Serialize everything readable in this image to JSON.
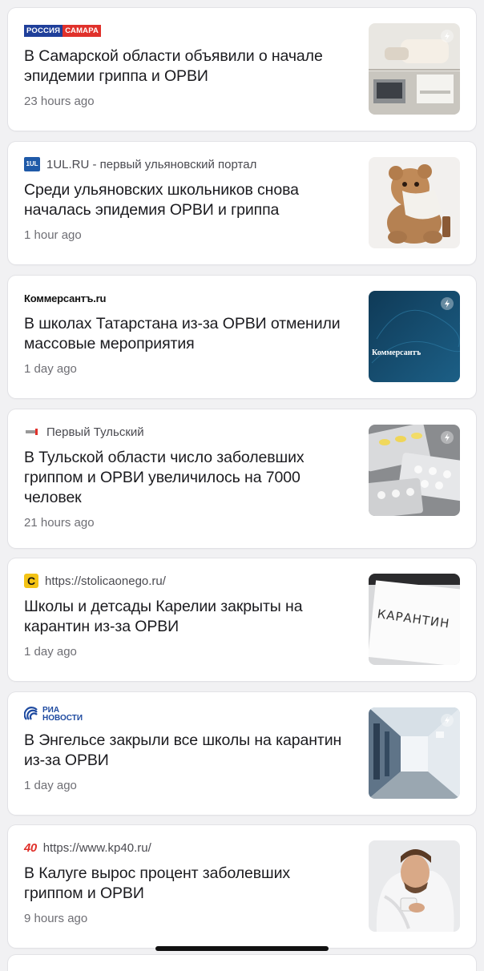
{
  "feed": {
    "articles": [
      {
        "source": "РОССИЯ САМАРА",
        "source_logo_parts": [
          "РОССИЯ",
          "САМАРА"
        ],
        "title": "В Самарской области объявили о начале эпидемии гриппа и ОРВИ",
        "time": "23 hours ago",
        "thumb_icon": "hand-with-paper-icon",
        "amp": true
      },
      {
        "source": "1UL.RU - первый ульяновский портал",
        "source_logo": "1UL",
        "title": "Среди ульяновских школьников снова началась эпидемия ОРВИ и гриппа",
        "time": "1 hour ago",
        "thumb_icon": "teddy-bear-icon",
        "amp": false
      },
      {
        "source": "Коммерсантъ.ru",
        "title": "В школах Татарстана из-за ОРВИ отменили массовые мероприятия",
        "time": "1 day ago",
        "thumb_icon": "kommersant-placeholder-icon",
        "thumb_caption": "Коммерсантъ",
        "amp": true
      },
      {
        "source": "Первый Тульский",
        "title": "В Тульской области число заболевших гриппом и ОРВИ увеличилось на 7000 человек",
        "time": "21 hours ago",
        "thumb_icon": "pills-blister-icon",
        "amp": true
      },
      {
        "source": "https://stolicaonego.ru/",
        "source_logo": "C",
        "title": "Школы и детсады Карелии закрыты на карантин из-за ОРВИ",
        "time": "1 day ago",
        "thumb_icon": "quarantine-sign-icon",
        "thumb_caption": "КАРАНТИН",
        "amp": false
      },
      {
        "source": "РИА НОВОСТИ",
        "source_logo_parts": [
          "РИА",
          "НОВОСТИ"
        ],
        "title": "В Энгельсе закрыли все школы на карантин из-за ОРВИ",
        "time": "1 day ago",
        "thumb_icon": "school-corridor-icon",
        "amp": true
      },
      {
        "source": "https://www.kp40.ru/",
        "source_logo": "40",
        "title": "В Калуге вырос процент заболевших гриппом и ОРВИ",
        "time": "9 hours ago",
        "thumb_icon": "sick-man-icon",
        "amp": false
      }
    ]
  },
  "colors": {
    "russia_blue": "#1f3f9a",
    "russia_red": "#e0312b",
    "kp40_red": "#e0312b",
    "ria_blue": "#1e4aa0"
  }
}
